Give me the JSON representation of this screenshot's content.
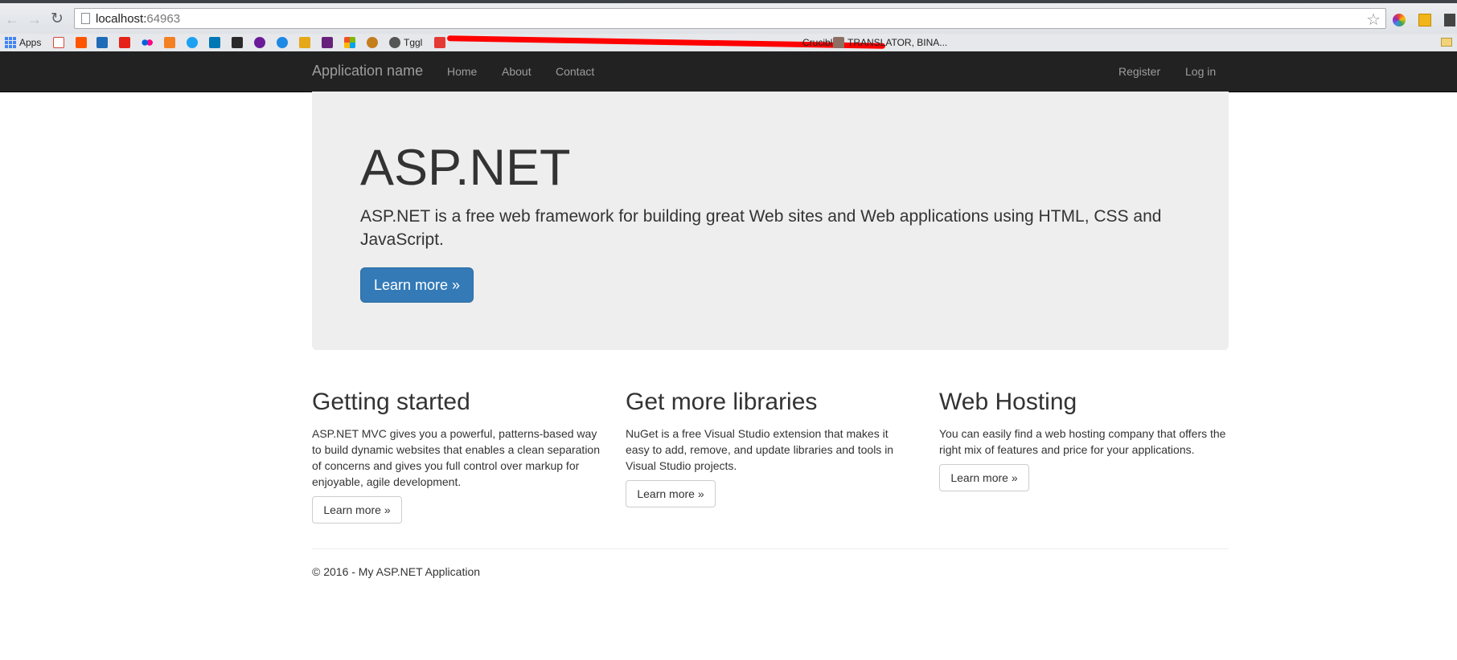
{
  "browser": {
    "url_host": "localhost:",
    "url_port": "64963",
    "bookmarks": {
      "apps_label": "Apps",
      "toggl_label": "Tggl",
      "crucible_label": "Crucible",
      "translator_label": "TRANSLATOR, BINA..."
    }
  },
  "navbar": {
    "brand": "Application name",
    "links": [
      "Home",
      "About",
      "Contact"
    ],
    "right_links": [
      "Register",
      "Log in"
    ]
  },
  "jumbotron": {
    "title": "ASP.NET",
    "lead": "ASP.NET is a free web framework for building great Web sites and Web applications using HTML, CSS and JavaScript.",
    "button": "Learn more »"
  },
  "columns": [
    {
      "heading": "Getting started",
      "text": "ASP.NET MVC gives you a powerful, patterns-based way to build dynamic websites that enables a clean separation of concerns and gives you full control over markup for enjoyable, agile development.",
      "button": "Learn more »"
    },
    {
      "heading": "Get more libraries",
      "text": "NuGet is a free Visual Studio extension that makes it easy to add, remove, and update libraries and tools in Visual Studio projects.",
      "button": "Learn more »"
    },
    {
      "heading": "Web Hosting",
      "text": "You can easily find a web hosting company that offers the right mix of features and price for your applications.",
      "button": "Learn more »"
    }
  ],
  "footer": {
    "text": "© 2016 - My ASP.NET Application"
  },
  "colors": {
    "navbar_bg": "#222222",
    "navbar_text": "#9d9d9d",
    "jumbotron_bg": "#eeeeee",
    "primary": "#337ab7"
  }
}
